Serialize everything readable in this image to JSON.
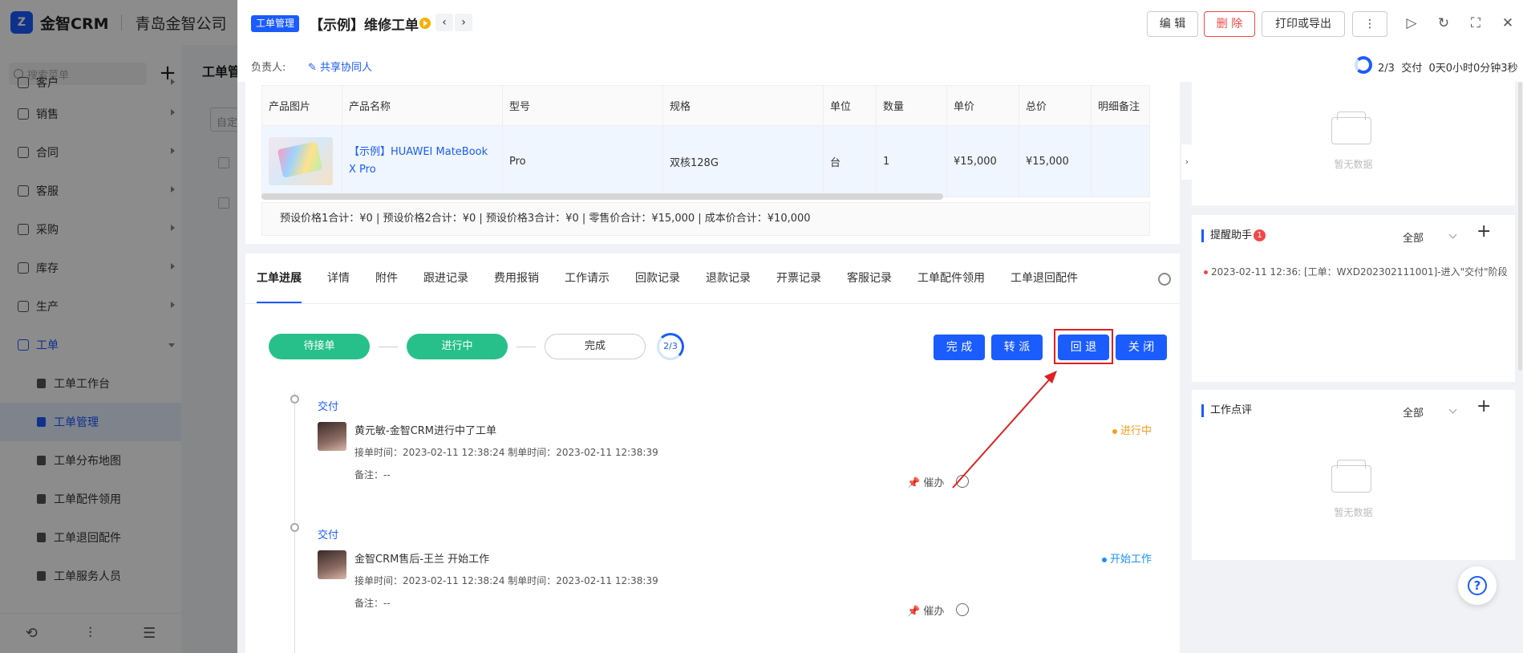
{
  "app": {
    "logo_mark": "Z",
    "brand": "金智CRM",
    "company": "青岛金智公司"
  },
  "sidebar": {
    "search_placeholder": "搜索菜单",
    "add_label": "+",
    "menu": [
      "客户",
      "销售",
      "合同",
      "客服",
      "采购",
      "库存",
      "生产",
      "工单"
    ],
    "submenu": [
      "工单工作台",
      "工单管理",
      "工单分布地图",
      "工单配件领用",
      "工单退回配件",
      "工单服务人员"
    ],
    "active_submenu": "工单管理",
    "bottom_icons": [
      "history-icon",
      "settings-sliders-icon",
      "collapse-menu-icon"
    ]
  },
  "background_page": {
    "title": "工单管",
    "input_text": "自定"
  },
  "drawer": {
    "badge": "工单管理",
    "title": "【示例】维修工单",
    "buttons": {
      "edit": "编 辑",
      "delete": "删 除",
      "print_export": "打印或导出",
      "more": "⋮"
    },
    "owner_label": "负责人:",
    "share_label": "共享协同人",
    "progress_text": "2/3",
    "stage_text": "交付",
    "duration_text": "0天0小时0分钟3秒"
  },
  "products": {
    "headers": [
      "产品图片",
      "产品名称",
      "型号",
      "规格",
      "单位",
      "数量",
      "单价",
      "总价",
      "明细备注"
    ],
    "rows": [
      {
        "name": "【示例】HUAWEI MateBook X Pro",
        "model": "Pro",
        "spec": "双核128G",
        "unit": "台",
        "qty": "1",
        "price": "¥15,000",
        "total": "¥15,000",
        "remark": ""
      }
    ],
    "totals": "预设价格1合计：¥0 |   预设价格2合计：¥0 |   预设价格3合计：¥0 |   零售价合计：¥15,000 |   成本价合计：¥10,000"
  },
  "tabs": [
    "工单进展",
    "详情",
    "附件",
    "跟进记录",
    "费用报销",
    "工作请示",
    "回款记录",
    "退款记录",
    "开票记录",
    "客服记录",
    "工单配件领用",
    "工单退回配件"
  ],
  "active_tab": "工单进展",
  "steps": [
    {
      "label": "待接单",
      "state": "done"
    },
    {
      "label": "进行中",
      "state": "done"
    },
    {
      "label": "完成",
      "state": "todo"
    }
  ],
  "step_progress": "2/3",
  "actions": {
    "complete": "完 成",
    "transfer": "转 派",
    "rollback": "回 退",
    "close": "关 闭"
  },
  "timeline": [
    {
      "stage": "交付",
      "actor": "黄元敏-金智CRM进行中了工单",
      "times": "接单时间：2023-02-11 12:38:24  制单时间：2023-02-11 12:38:39",
      "note": "备注：--",
      "status": "进行中",
      "status_color": "#fa9c1e",
      "urge": "催办"
    },
    {
      "stage": "交付",
      "actor": "金智CRM售后-王兰 开始工作",
      "times": "接单时间：2023-02-11 12:38:24  制单时间：2023-02-11 12:38:39",
      "note": "备注：--",
      "status": "开始工作",
      "status_color": "#1890ff",
      "urge": "催办"
    }
  ],
  "right": {
    "empty_text": "暂无数据",
    "reminder": {
      "title": "提醒助手",
      "badge": "1",
      "filter": "全部",
      "item": "2023-02-11 12:36: [工单：WXD202302111001]-进入\"交付\"阶段"
    },
    "review": {
      "title": "工作点评",
      "filter": "全部"
    }
  },
  "colors": {
    "primary": "#1a5cff",
    "success": "#27c08b",
    "danger": "#f04848",
    "highlight": "#e02020"
  }
}
